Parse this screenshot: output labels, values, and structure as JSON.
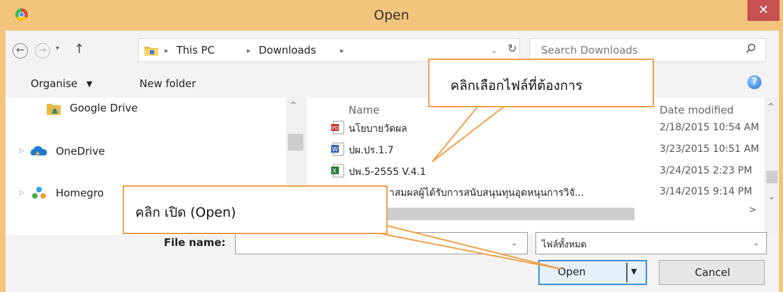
{
  "window": {
    "title": "Open",
    "close_label": "✕"
  },
  "nav": {
    "back": "←",
    "forward": "→",
    "recent": "▾",
    "up": "↑"
  },
  "address": {
    "crumbs": [
      "This PC",
      "Downloads"
    ],
    "separator": "▸",
    "dropdown": "⌄",
    "refresh": "↻"
  },
  "search": {
    "placeholder": "Search Downloads",
    "icon": "search-icon"
  },
  "toolbar": {
    "organise": "Organise",
    "organise_caret": "▼",
    "new_folder": "New folder",
    "help": "?"
  },
  "navpane": {
    "items": [
      {
        "label": "Google Drive",
        "icon": "google-drive-icon"
      },
      {
        "label": "OneDrive",
        "icon": "onedrive-icon"
      },
      {
        "label": "Homegro",
        "icon": "homegroup-icon"
      }
    ],
    "expand_arrow": "▷",
    "scroll_up": "^"
  },
  "filelist": {
    "columns": {
      "name": "Name",
      "date": "Date modified"
    },
    "files": [
      {
        "name": "นโยบายวัดผล",
        "date": "2/18/2015 10:54 AM",
        "type": "pdf"
      },
      {
        "name": "ปผ.ปร.1.7",
        "date": "3/23/2015 10:51 AM",
        "type": "word"
      },
      {
        "name": "ปพ.5-2555 V.4.1",
        "date": "3/24/2015 2:23 PM",
        "type": "excel"
      },
      {
        "name": "าสมผลผู้ได้รับการสนับสนุนทุนอุดหนุนการวิจั...",
        "date": "3/14/2015 9:14 PM",
        "type": "pdf"
      }
    ],
    "scroll_up": "^",
    "scroll_down": "⌄",
    "scroll_right": ">"
  },
  "bottom": {
    "file_name_label": "File name:",
    "file_name_value": "",
    "file_name_dropdown": "⌄",
    "filter": "ไฟล์ทั้งหมด",
    "filter_dropdown": "⌄",
    "open": "Open",
    "open_caret": "▼",
    "cancel": "Cancel"
  },
  "callouts": {
    "select_file": "คลิกเลือกไฟล์ที่ต้องการ",
    "click_open": "คลิก เปิด (Open)"
  },
  "colors": {
    "callout_border": "#f0a04b",
    "title_bar": "#f2c47c",
    "close_button": "#c75050",
    "open_button_border": "#3c8fd8"
  }
}
